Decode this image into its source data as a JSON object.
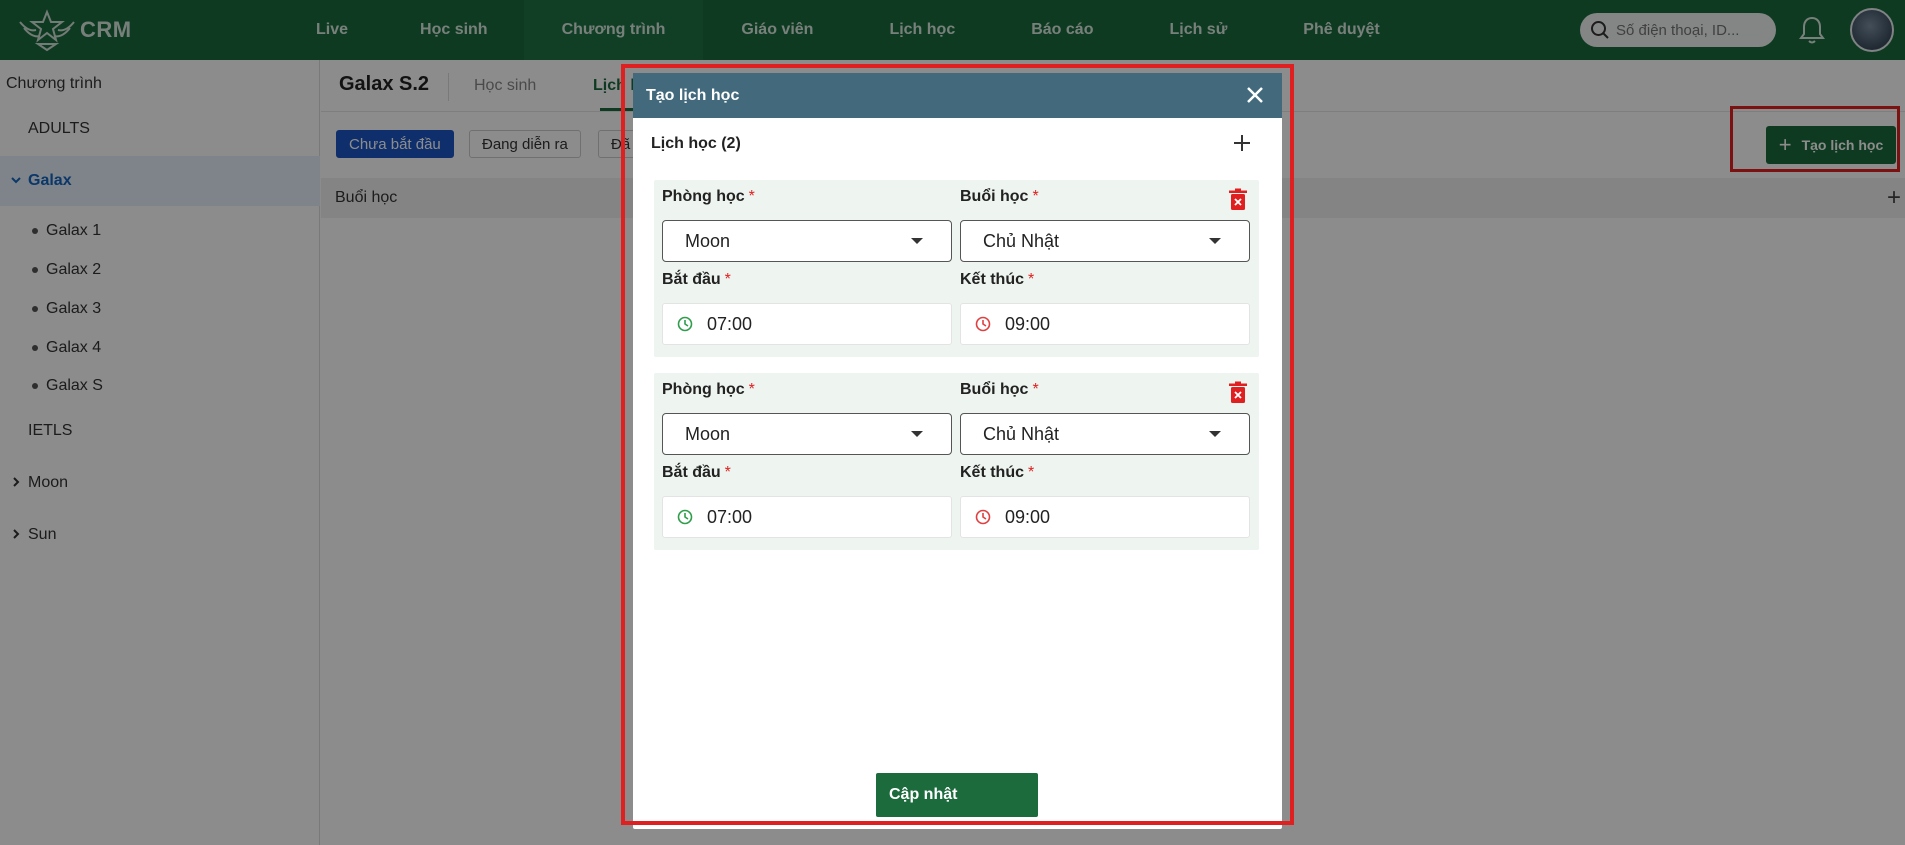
{
  "app": {
    "brand": "CRM"
  },
  "nav": {
    "items": [
      {
        "label": "Live"
      },
      {
        "label": "Học sinh"
      },
      {
        "label": "Chương trình",
        "active": true
      },
      {
        "label": "Giáo viên"
      },
      {
        "label": "Lịch học"
      },
      {
        "label": "Báo cáo"
      },
      {
        "label": "Lịch sử"
      },
      {
        "label": "Phê duyệt"
      }
    ],
    "search_placeholder": "Số điện thoại, ID..."
  },
  "sidebar": {
    "title": "Chương trình",
    "items": [
      {
        "label": "ADULTS"
      },
      {
        "label": "Galax",
        "expanded": true,
        "selected": true
      },
      {
        "label": "IETLS"
      },
      {
        "label": "Moon"
      },
      {
        "label": "Sun"
      }
    ],
    "galax_children": [
      "Galax 1",
      "Galax 2",
      "Galax 3",
      "Galax 4",
      "Galax S"
    ]
  },
  "main": {
    "title": "Galax S.2",
    "tabs": [
      "Học sinh",
      "Lịch h"
    ],
    "filters": [
      "Chưa bắt đầu",
      "Đang diễn ra",
      "Đã"
    ],
    "create_button": "Tạo lịch học",
    "table_header": "Buổi học"
  },
  "modal": {
    "title": "Tạo lịch học",
    "section_title": "Lịch học (2)",
    "labels": {
      "room": "Phòng học",
      "session": "Buổi học",
      "start": "Bắt đầu",
      "end": "Kết thúc",
      "required_mark": "*"
    },
    "schedules": [
      {
        "room": "Moon",
        "session": "Chủ Nhật",
        "start": "07:00",
        "end": "09:00"
      },
      {
        "room": "Moon",
        "session": "Chủ Nhật",
        "start": "07:00",
        "end": "09:00"
      }
    ],
    "submit_label": "Cập nhật"
  },
  "colors": {
    "primary_green": "#1b6b3d",
    "modal_header": "#426a7c",
    "highlight_red": "#e02020",
    "filter_active": "#1a56c4"
  }
}
